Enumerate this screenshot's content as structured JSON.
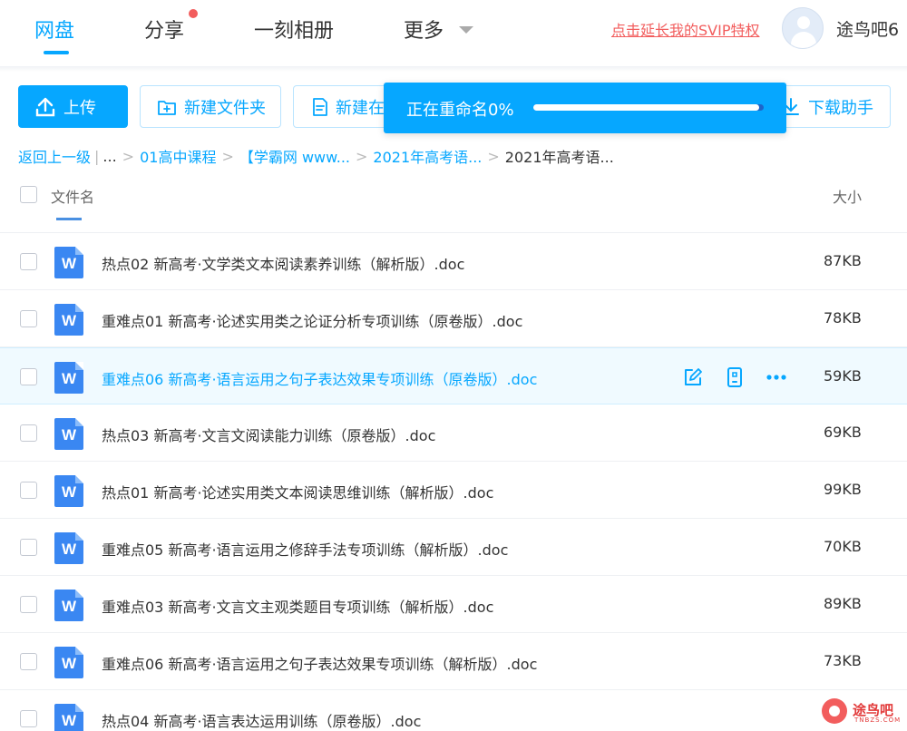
{
  "nav": {
    "items": [
      {
        "label": "网盘",
        "active": true
      },
      {
        "label": "分享",
        "active": false
      },
      {
        "label": "一刻相册",
        "active": false
      },
      {
        "label": "更多",
        "active": false
      }
    ],
    "svip_link": "点击延长我的SVIP特权",
    "username": "途鸟吧6"
  },
  "toolbar": {
    "upload": "上传",
    "new_folder": "新建文件夹",
    "new_doc": "新建在",
    "download_helper": "下载助手"
  },
  "toast": {
    "text": "正在重命名0%",
    "progress": 0.98
  },
  "breadcrumb": {
    "back": "返回上一级",
    "ellipsis": "...",
    "items": [
      "01高中课程",
      "【学霸网 www...",
      "2021年高考语..."
    ],
    "current": "2021年高考语..."
  },
  "table": {
    "col_name": "文件名",
    "col_size": "大小",
    "file_icon_letter": "W",
    "rows": [
      {
        "name": "热点02 新高考·文学类文本阅读素养训练（解析版）.doc",
        "size": "87KB",
        "hover": false
      },
      {
        "name": "重难点01 新高考·论述实用类之论证分析专项训练（原卷版）.doc",
        "size": "78KB",
        "hover": false
      },
      {
        "name": "重难点06 新高考·语言运用之句子表达效果专项训练（原卷版）.doc",
        "size": "59KB",
        "hover": true
      },
      {
        "name": "热点03 新高考·文言文阅读能力训练（原卷版）.doc",
        "size": "69KB",
        "hover": false
      },
      {
        "name": "热点01 新高考·论述实用类文本阅读思维训练（解析版）.doc",
        "size": "99KB",
        "hover": false
      },
      {
        "name": "重难点05 新高考·语言运用之修辞手法专项训练（解析版）.doc",
        "size": "70KB",
        "hover": false
      },
      {
        "name": "重难点03 新高考·文言文主观类题目专项训练（解析版）.doc",
        "size": "89KB",
        "hover": false
      },
      {
        "name": "重难点06 新高考·语言运用之句子表达效果专项训练（解析版）.doc",
        "size": "73KB",
        "hover": false
      },
      {
        "name": "热点04 新高考·语言表达运用训练（原卷版）.doc",
        "size": "",
        "hover": false
      }
    ]
  },
  "icons": {
    "upload": "upload-icon",
    "new_folder": "folder-plus-icon",
    "new_doc": "document-icon",
    "download": "download-icon",
    "rename": "edit-icon",
    "phone": "phone-icon",
    "more": "more-icon"
  },
  "colors": {
    "accent": "#06a7ff",
    "svip": "#f25d5d",
    "word_icon": "#3a87f2"
  },
  "watermark": {
    "text": "途鸟吧",
    "sub": "TNBZS.COM"
  }
}
